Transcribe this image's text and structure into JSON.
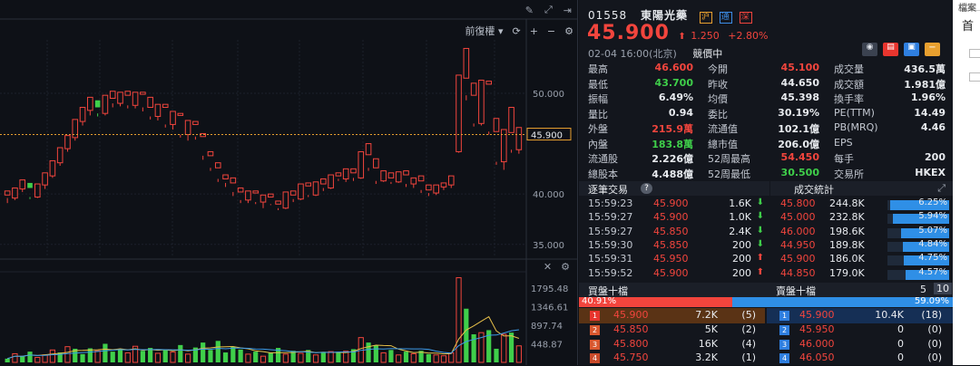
{
  "toolbar": {
    "adjust_label": "前復權"
  },
  "chart_data": [
    {
      "type": "candlestick",
      "title": "",
      "y_ticks": [
        "50.000",
        "45.900",
        "40.000",
        "35.000"
      ],
      "high_label": "54.450",
      "last_price_label": "45.900",
      "last_price": 45.9,
      "ylim": [
        33.9,
        55.3
      ],
      "up_color": "#f2453d",
      "down_color": "#3fcf4a",
      "candles": [
        [
          39.9,
          40.3,
          39.1,
          39.6
        ],
        [
          39.6,
          40.6,
          39.4,
          40.5
        ],
        [
          40.5,
          41.4,
          40.2,
          41.1
        ],
        [
          41.1,
          40.6,
          39.5,
          39.7
        ],
        [
          39.7,
          41.0,
          39.6,
          40.9
        ],
        [
          40.9,
          42.1,
          40.5,
          41.8
        ],
        [
          41.8,
          43.3,
          41.6,
          43.1
        ],
        [
          43.1,
          44.6,
          42.8,
          44.5
        ],
        [
          44.5,
          45.8,
          44.2,
          45.6
        ],
        [
          45.6,
          47.4,
          45.3,
          47.2
        ],
        [
          47.2,
          48.6,
          46.8,
          48.3
        ],
        [
          48.3,
          49.6,
          47.8,
          49.3
        ],
        [
          49.3,
          48.6,
          47.7,
          48.0
        ],
        [
          48.0,
          49.8,
          47.8,
          49.5
        ],
        [
          49.5,
          50.2,
          48.6,
          49.0
        ],
        [
          49.0,
          50.1,
          48.7,
          49.8
        ],
        [
          49.8,
          50.2,
          48.5,
          48.8
        ],
        [
          48.8,
          50.1,
          48.5,
          49.9
        ],
        [
          49.9,
          50.1,
          48.2,
          48.6
        ],
        [
          48.6,
          49.6,
          47.4,
          47.7
        ],
        [
          47.7,
          48.9,
          47.3,
          48.6
        ],
        [
          48.6,
          48.9,
          46.6,
          46.9
        ],
        [
          46.9,
          48.2,
          46.4,
          47.8
        ],
        [
          47.8,
          48.0,
          45.6,
          45.9
        ],
        [
          45.9,
          47.3,
          45.3,
          46.9
        ],
        [
          46.9,
          47.2,
          45.4,
          45.7
        ],
        [
          45.7,
          46.0,
          43.4,
          43.8
        ],
        [
          43.8,
          44.2,
          42.3,
          42.6
        ],
        [
          42.6,
          43.1,
          41.2,
          41.5
        ],
        [
          41.5,
          41.9,
          40.7,
          41.1
        ],
        [
          41.1,
          41.6,
          39.8,
          40.2
        ],
        [
          40.2,
          40.6,
          39.1,
          39.4
        ],
        [
          39.4,
          40.3,
          39.1,
          40.1
        ],
        [
          40.1,
          40.3,
          39.0,
          39.2
        ],
        [
          39.2,
          39.9,
          38.6,
          39.7
        ],
        [
          39.7,
          40.0,
          38.9,
          39.0
        ],
        [
          39.0,
          39.3,
          38.4,
          38.6
        ],
        [
          38.6,
          40.2,
          38.5,
          39.9
        ],
        [
          39.9,
          40.3,
          39.2,
          39.5
        ],
        [
          39.5,
          41.0,
          39.4,
          40.8
        ],
        [
          40.8,
          41.1,
          39.7,
          39.9
        ],
        [
          39.9,
          41.2,
          39.8,
          41.0
        ],
        [
          41.0,
          41.5,
          40.3,
          40.6
        ],
        [
          40.6,
          41.9,
          40.5,
          41.8
        ],
        [
          41.8,
          42.1,
          41.3,
          41.5
        ],
        [
          41.5,
          42.5,
          41.2,
          42.1
        ],
        [
          42.1,
          42.5,
          41.3,
          41.6
        ],
        [
          41.6,
          44.2,
          41.5,
          43.9
        ],
        [
          43.9,
          45.0,
          42.3,
          42.6
        ],
        [
          42.6,
          43.5,
          41.0,
          41.3
        ],
        [
          41.3,
          42.3,
          41.2,
          41.6
        ],
        [
          41.6,
          42.1,
          41.0,
          41.2
        ],
        [
          41.2,
          42.2,
          41.1,
          41.9
        ],
        [
          41.9,
          42.3,
          40.7,
          41.0
        ],
        [
          41.0,
          41.6,
          40.6,
          41.3
        ],
        [
          41.3,
          41.8,
          40.1,
          40.4
        ],
        [
          40.4,
          40.9,
          39.8,
          40.1
        ],
        [
          40.1,
          40.9,
          39.9,
          40.7
        ],
        [
          40.7,
          41.1,
          40.4,
          40.9
        ],
        [
          40.9,
          41.8,
          40.6,
          41.7
        ],
        [
          44.2,
          51.8,
          44.1,
          51.5
        ],
        [
          51.5,
          54.45,
          49.3,
          49.8
        ],
        [
          49.8,
          51.0,
          46.7,
          47.0
        ],
        [
          47.0,
          51.3,
          46.8,
          50.9
        ],
        [
          50.9,
          51.2,
          45.9,
          46.2
        ],
        [
          46.2,
          47.5,
          42.9,
          43.2
        ],
        [
          43.2,
          46.4,
          42.4,
          46.1
        ],
        [
          46.1,
          48.6,
          44.1,
          44.4
        ],
        [
          44.4,
          46.6,
          44.0,
          45.9
        ]
      ]
    },
    {
      "type": "bar",
      "title": "",
      "y_ticks": [
        "1795.48",
        "1346.61",
        "897.74",
        "448.87"
      ],
      "ylim": [
        0,
        2150
      ],
      "volumes": [
        [
          90,
          "g"
        ],
        [
          210,
          "r"
        ],
        [
          150,
          "g"
        ],
        [
          260,
          "g"
        ],
        [
          120,
          "r"
        ],
        [
          180,
          "r"
        ],
        [
          300,
          "r"
        ],
        [
          240,
          "g"
        ],
        [
          380,
          "r"
        ],
        [
          330,
          "g"
        ],
        [
          200,
          "g"
        ],
        [
          340,
          "g"
        ],
        [
          280,
          "r"
        ],
        [
          450,
          "g"
        ],
        [
          260,
          "g"
        ],
        [
          310,
          "g"
        ],
        [
          230,
          "r"
        ],
        [
          390,
          "r"
        ],
        [
          280,
          "g"
        ],
        [
          350,
          "g"
        ],
        [
          220,
          "r"
        ],
        [
          300,
          "g"
        ],
        [
          250,
          "r"
        ],
        [
          420,
          "g"
        ],
        [
          200,
          "r"
        ],
        [
          360,
          "g"
        ],
        [
          480,
          "g"
        ],
        [
          300,
          "g"
        ],
        [
          520,
          "g"
        ],
        [
          240,
          "g"
        ],
        [
          380,
          "g"
        ],
        [
          310,
          "g"
        ],
        [
          200,
          "r"
        ],
        [
          260,
          "g"
        ],
        [
          150,
          "r"
        ],
        [
          230,
          "g"
        ],
        [
          350,
          "g"
        ],
        [
          200,
          "r"
        ],
        [
          280,
          "g"
        ],
        [
          220,
          "r"
        ],
        [
          300,
          "g"
        ],
        [
          180,
          "r"
        ],
        [
          250,
          "g"
        ],
        [
          260,
          "r"
        ],
        [
          230,
          "g"
        ],
        [
          270,
          "r"
        ],
        [
          320,
          "g"
        ],
        [
          600,
          "r"
        ],
        [
          480,
          "g"
        ],
        [
          410,
          "g"
        ],
        [
          230,
          "r"
        ],
        [
          300,
          "g"
        ],
        [
          180,
          "r"
        ],
        [
          260,
          "g"
        ],
        [
          210,
          "r"
        ],
        [
          280,
          "g"
        ],
        [
          200,
          "g"
        ],
        [
          180,
          "r"
        ],
        [
          160,
          "r"
        ],
        [
          230,
          "r"
        ],
        [
          2050,
          "r"
        ],
        [
          1300,
          "g"
        ],
        [
          680,
          "g"
        ],
        [
          720,
          "r"
        ],
        [
          780,
          "g"
        ],
        [
          330,
          "g"
        ],
        [
          680,
          "r"
        ],
        [
          720,
          "g"
        ],
        [
          400,
          "r"
        ]
      ]
    }
  ],
  "quote": {
    "code": "01558",
    "name": "東陽光藥",
    "badge1": "沪",
    "badge2": "通",
    "badge3": "深",
    "price": "45.900",
    "arrow": "⬆",
    "change": "1.250",
    "change_pct": "+2.80%",
    "time": "02-04  16:00(北京)",
    "status": "競價中",
    "stats": [
      {
        "l1": "最高",
        "v1": "46.600",
        "c1": "red",
        "l2": "今開",
        "v2": "45.100",
        "c2": "red",
        "l3": "成交量",
        "v3": "436.5萬",
        "c3": "white"
      },
      {
        "l1": "最低",
        "v1": "43.700",
        "c1": "green",
        "l2": "昨收",
        "v2": "44.650",
        "c2": "white",
        "l3": "成交額",
        "v3": "1.981億",
        "c3": "white"
      },
      {
        "l1": "振幅",
        "v1": "6.49%",
        "c1": "white",
        "l2": "均價",
        "v2": "45.398",
        "c2": "white",
        "l3": "換手率",
        "v3": "1.96%",
        "c3": "white"
      },
      {
        "l1": "量比",
        "v1": "0.94",
        "c1": "white",
        "l2": "委比",
        "v2": "30.19%",
        "c2": "white",
        "l3": "PE(TTM)",
        "v3": "14.49",
        "c3": "white"
      },
      {
        "l1": "外盤",
        "v1": "215.9萬",
        "c1": "red",
        "l2": "流通值",
        "v2": "102.1億",
        "c2": "white",
        "l3": "PB(MRQ)",
        "v3": "4.46",
        "c3": "white"
      },
      {
        "l1": "內盤",
        "v1": "183.8萬",
        "c1": "green",
        "l2": "總市值",
        "v2": "206.0億",
        "c2": "white",
        "l3": "EPS",
        "v3": "",
        "c3": "white"
      },
      {
        "l1": "流通股",
        "v1": "2.226億",
        "c1": "white",
        "l2": "52周最高",
        "v2": "54.450",
        "c2": "red",
        "l3": "每手",
        "v3": "200",
        "c3": "white"
      },
      {
        "l1": "總股本",
        "v1": "4.488億",
        "c1": "white",
        "l2": "52周最低",
        "v2": "30.500",
        "c2": "green",
        "l3": "交易所",
        "v3": "HKEX",
        "c3": "white"
      }
    ],
    "ticks_title": "逐筆交易",
    "vol_title": "成交統計",
    "ticks": [
      {
        "t": "15:59:23",
        "p": "45.900",
        "c": "red",
        "q": "1.6K",
        "d": "green"
      },
      {
        "t": "15:59:27",
        "p": "45.900",
        "c": "red",
        "q": "1.0K",
        "d": "green"
      },
      {
        "t": "15:59:27",
        "p": "45.850",
        "c": "red",
        "q": "2.4K",
        "d": "green"
      },
      {
        "t": "15:59:30",
        "p": "45.850",
        "c": "red",
        "q": "200",
        "d": "green"
      },
      {
        "t": "15:59:31",
        "p": "45.950",
        "c": "red",
        "q": "200",
        "d": "red"
      },
      {
        "t": "15:59:52",
        "p": "45.900",
        "c": "red",
        "q": "200",
        "d": "red"
      }
    ],
    "volstats": [
      {
        "p": "45.800",
        "c": "red",
        "v": "244.8K",
        "pct": "6.25%",
        "w": 0.625
      },
      {
        "p": "45.000",
        "c": "red",
        "v": "232.8K",
        "pct": "5.94%",
        "w": 0.594
      },
      {
        "p": "46.000",
        "c": "red",
        "v": "198.6K",
        "pct": "5.07%",
        "w": 0.507
      },
      {
        "p": "44.950",
        "c": "red",
        "v": "189.8K",
        "pct": "4.84%",
        "w": 0.484
      },
      {
        "p": "45.900",
        "c": "red",
        "v": "186.0K",
        "pct": "4.75%",
        "w": 0.475
      },
      {
        "p": "44.850",
        "c": "red",
        "v": "179.0K",
        "pct": "4.57%",
        "w": 0.457
      }
    ],
    "buy_title": "買盤十檔",
    "sell_title": "賣盤十檔",
    "depth_5": "5",
    "depth_10": "10",
    "buy_pct": "40.91%",
    "sell_pct": "59.09%",
    "buy_ratio": 0.4091,
    "bids": [
      {
        "i": "1",
        "p": "45.900",
        "q": "7.2K",
        "n": "(5)"
      },
      {
        "i": "2",
        "p": "45.850",
        "q": "5K",
        "n": "(2)"
      },
      {
        "i": "3",
        "p": "45.800",
        "q": "16K",
        "n": "(4)"
      },
      {
        "i": "4",
        "p": "45.750",
        "q": "3.2K",
        "n": "(1)"
      }
    ],
    "asks": [
      {
        "i": "1",
        "p": "45.900",
        "q": "10.4K",
        "n": "(18)"
      },
      {
        "i": "2",
        "p": "45.950",
        "q": "0",
        "n": "(0)"
      },
      {
        "i": "3",
        "p": "46.000",
        "q": "0",
        "n": "(0)"
      },
      {
        "i": "4",
        "p": "46.050",
        "q": "0",
        "n": "(0)"
      }
    ]
  },
  "sidebar": {
    "text1": "檔案",
    "text2": "首"
  }
}
